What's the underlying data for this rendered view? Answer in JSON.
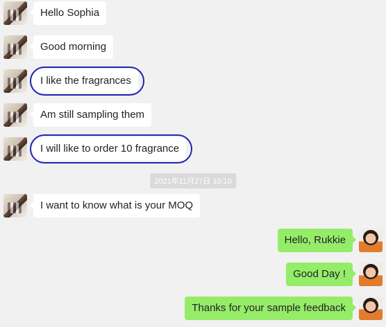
{
  "messages": [
    {
      "side": "left",
      "text": "Hello Sophia"
    },
    {
      "side": "left",
      "text": "Good morning"
    },
    {
      "side": "left",
      "text": "I like the fragrances",
      "circled": true
    },
    {
      "side": "left",
      "text": "Am still sampling them"
    },
    {
      "side": "left",
      "text": "I will like to order 10 fragrance",
      "circled": true
    },
    {
      "side": "left",
      "text": "I want to know what is your MOQ"
    },
    {
      "side": "right",
      "text": "Hello, Rukkie"
    },
    {
      "side": "right",
      "text": "Good Day !"
    },
    {
      "side": "right",
      "text": "Thanks for your sample feedback"
    }
  ],
  "timestamp": "2021年11月27日 10:10",
  "colors": {
    "background": "#f1f1f1",
    "incoming": "#ffffff",
    "outgoing": "#95ec69",
    "annotation": "#2323b5"
  },
  "avatars": {
    "contact": "store-avatar",
    "self": "person-avatar"
  }
}
